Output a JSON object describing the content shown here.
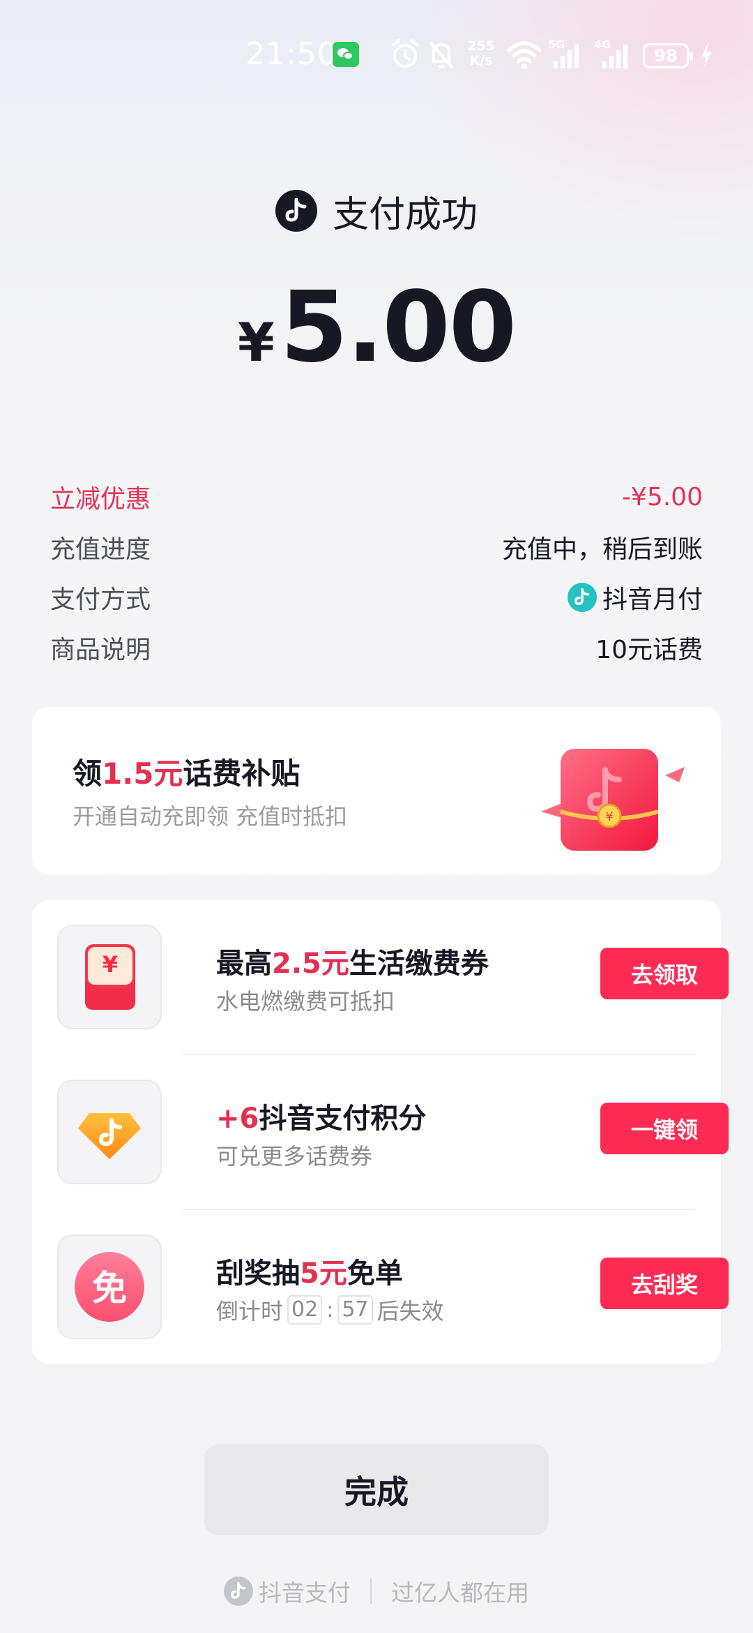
{
  "status_bar": {
    "time": "21:50",
    "net_speed_value": "255",
    "net_speed_unit": "K/s",
    "signal1_label": "5G",
    "signal2_label": "4G",
    "battery": "98"
  },
  "header": {
    "title": "支付成功",
    "currency": "¥",
    "amount": "5.00"
  },
  "details": [
    {
      "label": "立减优惠",
      "value": "-¥5.00"
    },
    {
      "label": "充值进度",
      "value": "充值中，稍后到账"
    },
    {
      "label": "支付方式",
      "value": "抖音月付"
    },
    {
      "label": "商品说明",
      "value": "10元话费"
    }
  ],
  "subsidy": {
    "title_prefix": "领",
    "title_highlight": "1.5元",
    "title_suffix": "话费补贴",
    "subtitle": "开通自动充即领 充值时抵扣",
    "coin_symbol": "¥"
  },
  "rewards": [
    {
      "icon": "red-envelope-icon",
      "title_prefix": "最高",
      "title_highlight": "2.5元",
      "title_suffix": "生活缴费券",
      "subtitle": "水电燃缴费可抵扣",
      "button": "去领取",
      "icon_symbol": "¥"
    },
    {
      "icon": "points-gem-icon",
      "title_prefix": "",
      "title_highlight": "+6",
      "title_suffix": "抖音支付积分",
      "subtitle": "可兑更多话费券",
      "button": "一键领"
    },
    {
      "icon": "free-order-icon",
      "title_prefix": "刮奖抽",
      "title_highlight": "5元",
      "title_suffix": "免单",
      "subtitle_prefix": "倒计时",
      "countdown_min": "02",
      "countdown_sep": ":",
      "countdown_sec": "57",
      "subtitle_suffix": "后失效",
      "button": "去刮奖",
      "icon_symbol": "免"
    }
  ],
  "done_button": "完成",
  "footer": {
    "brand": "抖音支付",
    "slogan": "过亿人都在用"
  },
  "colors": {
    "accent_red": "#fe2c55",
    "highlight_red": "#e4304f",
    "pay_icon_teal": "#25c2c3"
  }
}
